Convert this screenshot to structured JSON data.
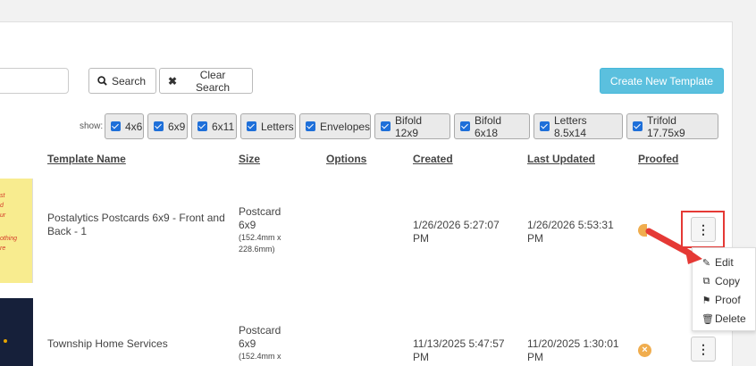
{
  "toolbar": {
    "search_label": "Search",
    "clear_label": "Clear Search",
    "create_label": "Create New Template",
    "search_placeholder": ""
  },
  "filters": {
    "show_label": "show:",
    "items": [
      "4x6",
      "6x9",
      "6x11",
      "Letters",
      "Envelopes",
      "Bifold 12x9",
      "Bifold 6x18",
      "Letters 8.5x14",
      "Trifold 17.75x9"
    ]
  },
  "table": {
    "headers": {
      "name": "Template Name",
      "size": "Size",
      "options": "Options",
      "created": "Created",
      "updated": "Last Updated",
      "proofed": "Proofed"
    },
    "rows": [
      {
        "name_line1": "Postalytics Postcards 6x9 - Front and",
        "name_line2": "Back - 1",
        "size_type": "Postcard",
        "size_dim": "6x9",
        "size_mm1": "(152.4mm x",
        "size_mm2": "228.6mm)",
        "created_date": "1/26/2026 5:27:07",
        "created_ampm": "PM",
        "updated_date": "1/26/2026 5:53:31",
        "updated_ampm": "PM",
        "thumb_text": [
          "st",
          "d",
          "ur",
          "",
          "othing",
          "re"
        ]
      },
      {
        "name_line1": "Township Home Services",
        "size_type": "Postcard",
        "size_dim": "6x9",
        "size_mm1": "(152.4mm x",
        "created_date": "11/13/2025 5:47:57",
        "created_ampm": "PM",
        "updated_date": "11/20/2025 1:30:01",
        "updated_ampm": "PM",
        "proofed_icon": "×"
      }
    ]
  },
  "menu": {
    "edit": "Edit",
    "copy": "Copy",
    "proof": "Proof",
    "delete": "Delete"
  },
  "colors": {
    "accent": "#5bc0de",
    "checkbox": "#1e6fd9",
    "status": "#f0ad4e",
    "highlight": "#e53935"
  }
}
